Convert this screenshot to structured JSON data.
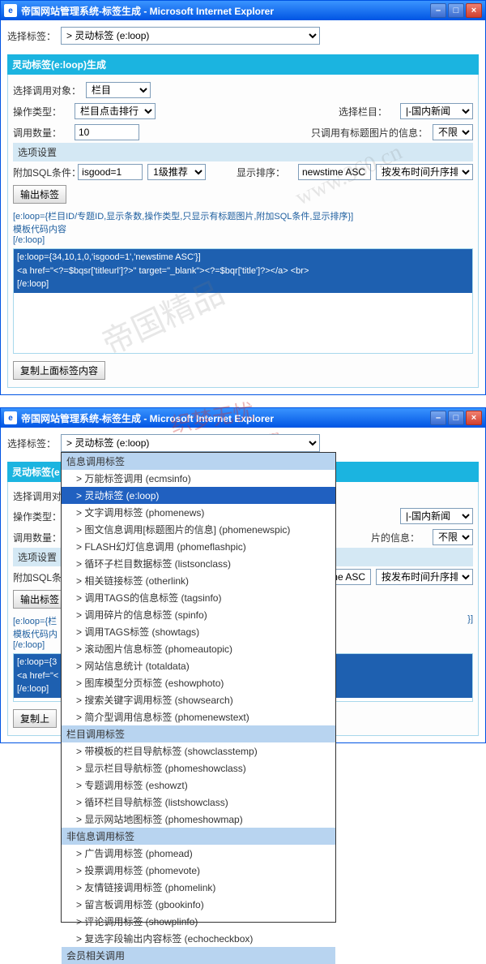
{
  "window1": {
    "title": "帝国网站管理系统-标签生成 - Microsoft Internet Explorer",
    "selectLabel": "选择标签：",
    "selectValue": "  > 灵动标签 (e:loop)",
    "panel": {
      "header": "灵动标签(e:loop)生成",
      "targetLabel": "选择调用对象：",
      "targetValue": "栏目",
      "opTypeLabel": "操作类型：",
      "opTypeValue": "栏目点击排行",
      "colLabel": "选择栏目：",
      "colValue": "|-国内新闻",
      "countLabel": "调用数量：",
      "countValue": "10",
      "picLabel": "只调用有标题图片的信息：",
      "picValue": "不限",
      "optionHeader": "选项设置",
      "sqlLabel": "附加SQL条件：",
      "sqlValue": "isgood=1",
      "sqlNote": "1级推荐",
      "sortLabel": "显示排序：",
      "sortValue": "newstime ASC",
      "sortNote": "按发布时间升序排序",
      "outputBtn": "输出标签",
      "templateDesc": "[e:loop={栏目ID/专题ID,显示条数,操作类型,只显示有标题图片,附加SQL条件,显示排序}]\n模板代码内容\n[/e:loop]",
      "code1": "[e:loop={34,10,1,0,'isgood=1','newstime ASC'}]",
      "code2": "<a href=\"<?=$bqsr['titleurl']?>\" target=\"_blank\"><?=$bqr['title']?></a> <br>",
      "code3": "[/e:loop]",
      "copyBtn": "复制上面标签内容"
    }
  },
  "window2": {
    "title": "帝国网站管理系统-标签生成 - Microsoft Internet Explorer",
    "selectLabel": "选择标签：",
    "selectValue": "  > 灵动标签 (e:loop)",
    "dropdown": {
      "groups": [
        {
          "label": "信息调用标签",
          "items": [
            "> 万能标签调用 (ecmsinfo)",
            "> 灵动标签 (e:loop)",
            "> 文字调用标签 (phomenews)",
            "> 图文信息调用[标题图片的信息] (phomenewspic)",
            "> FLASH幻灯信息调用 (phomeflashpic)",
            "> 循环子栏目数据标签 (listsonclass)",
            "> 相关链接标签 (otherlink)",
            "> 调用TAGS的信息标签 (tagsinfo)",
            "> 调用碎片的信息标签 (spinfo)",
            "> 调用TAGS标签 (showtags)",
            "> 滚动图片信息标签 (phomeautopic)",
            "> 网站信息统计 (totaldata)",
            "> 图库模型分页标签 (eshowphoto)",
            "> 搜索关键字调用标签 (showsearch)",
            "> 简介型调用信息标签 (phomenewstext)"
          ],
          "selectedIndex": 1
        },
        {
          "label": "栏目调用标签",
          "items": [
            "> 带模板的栏目导航标签 (showclasstemp)",
            "> 显示栏目导航标签 (phomeshowclass)",
            "> 专题调用标签 (eshowzt)",
            "> 循环栏目导航标签 (listshowclass)",
            "> 显示网站地图标签 (phomeshowmap)"
          ]
        },
        {
          "label": "非信息调用标签",
          "items": [
            "> 广告调用标签 (phomead)",
            "> 投票调用标签 (phomevote)",
            "> 友情链接调用标签 (phomelink)",
            "> 留言板调用标签 (gbookinfo)",
            "> 评论调用标签 (showplinfo)",
            "> 复选字段输出内容标签 (echocheckbox)"
          ]
        },
        {
          "label": "会员相关调用",
          "items": []
        }
      ]
    },
    "panel": {
      "header": "灵动标签(e",
      "targetLabel": "选择调用对",
      "opTypeLabel": "操作类型：",
      "colValue": "|-国内新闻",
      "countLabel": "调用数量：",
      "picLabel": "片的信息：",
      "picValue": "不限",
      "optionHeader": "选项设置",
      "sqlLabel": "附加SQL条",
      "sortValue": "newstime ASC",
      "sortNote": "按发布时间升序排序",
      "outputBtn": "输出标签",
      "desc1": "[e:loop={栏",
      "desc2": "模板代码内",
      "desc3": "[/e:loop]",
      "code1": "[e:loop={3",
      "code2": "<a href=\"<",
      "code3": "[/e:loop]",
      "copyBtn": "复制上"
    }
  },
  "watermarks": {
    "wm1": "帝国精品",
    "wm2": "织梦无忧",
    "wm3": "dedecms51.com",
    "wm4": "www.360.cn"
  }
}
